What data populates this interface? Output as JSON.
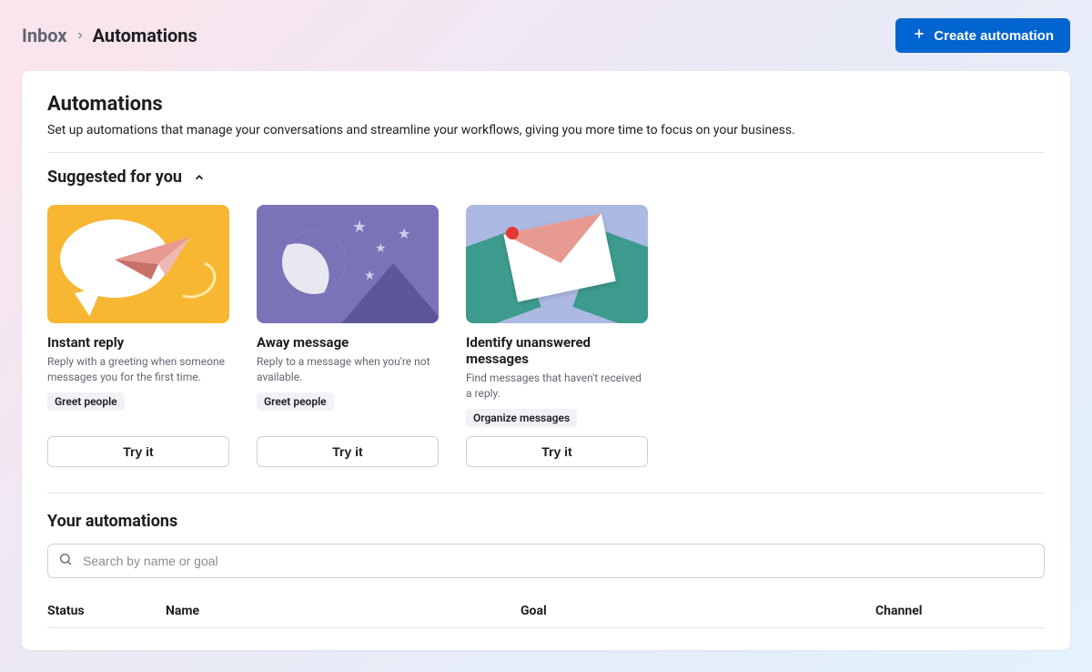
{
  "breadcrumb": {
    "root": "Inbox",
    "current": "Automations"
  },
  "create_button": "Create automation",
  "header": {
    "title": "Automations",
    "description": "Set up automations that manage your conversations and streamline your workflows, giving you more time to focus on your business."
  },
  "suggested": {
    "title": "Suggested for you",
    "cards": [
      {
        "title": "Instant reply",
        "description": "Reply with a greeting when someone messages you for the first time.",
        "tag": "Greet people",
        "cta": "Try it"
      },
      {
        "title": "Away message",
        "description": "Reply to a message when you're not available.",
        "tag": "Greet people",
        "cta": "Try it"
      },
      {
        "title": "Identify unanswered messages",
        "description": "Find messages that haven't received a reply.",
        "tag": "Organize messages",
        "cta": "Try it"
      }
    ]
  },
  "your_automations": {
    "title": "Your automations",
    "search_placeholder": "Search by name or goal",
    "columns": {
      "status": "Status",
      "name": "Name",
      "goal": "Goal",
      "channel": "Channel"
    }
  }
}
